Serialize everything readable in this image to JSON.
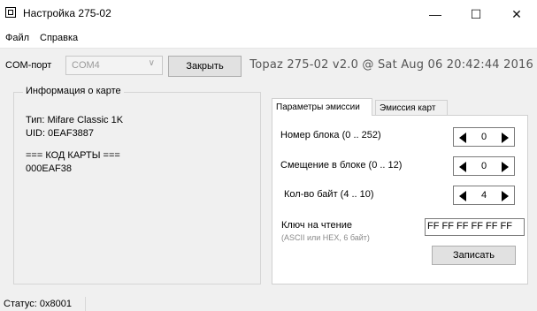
{
  "window": {
    "title": "Настройка 275-02",
    "controls": {
      "minimize": "—",
      "maximize": "☐",
      "close": "✕"
    }
  },
  "menu": {
    "items": [
      "Файл",
      "Справка"
    ]
  },
  "toolbar": {
    "com_label": "COM-порт",
    "com_value": "COM4",
    "close_button": "Закрыть",
    "version": "Topaz 275-02 v2.0 @ Sat Aug 06 20:42:44 2016"
  },
  "card_info": {
    "title": "Информация о карте",
    "type_line": "Тип: Mifare Classic 1K",
    "uid_line": "UID: 0EAF3887",
    "code_header": "=== КОД КАРТЫ ===",
    "code_value": "000EAF38"
  },
  "tabs": [
    {
      "label": "Параметры эмиссии",
      "active": true
    },
    {
      "label": "Эмиссия карт",
      "active": false
    }
  ],
  "params": {
    "block_number": {
      "label": "Номер блока (0 .. 252)",
      "value": "0"
    },
    "block_offset": {
      "label": "Смещение в блоке (0 .. 12)",
      "value": "0"
    },
    "byte_count": {
      "label": "Кол-во байт (4 .. 10)",
      "value": "4"
    },
    "read_key": {
      "label": "Ключ на чтение",
      "hint": "(ASCII или HEX, 6 байт)",
      "value": "FF FF FF FF FF FF"
    },
    "write_button": "Записать"
  },
  "status": {
    "text": "Статус: 0x8001"
  }
}
